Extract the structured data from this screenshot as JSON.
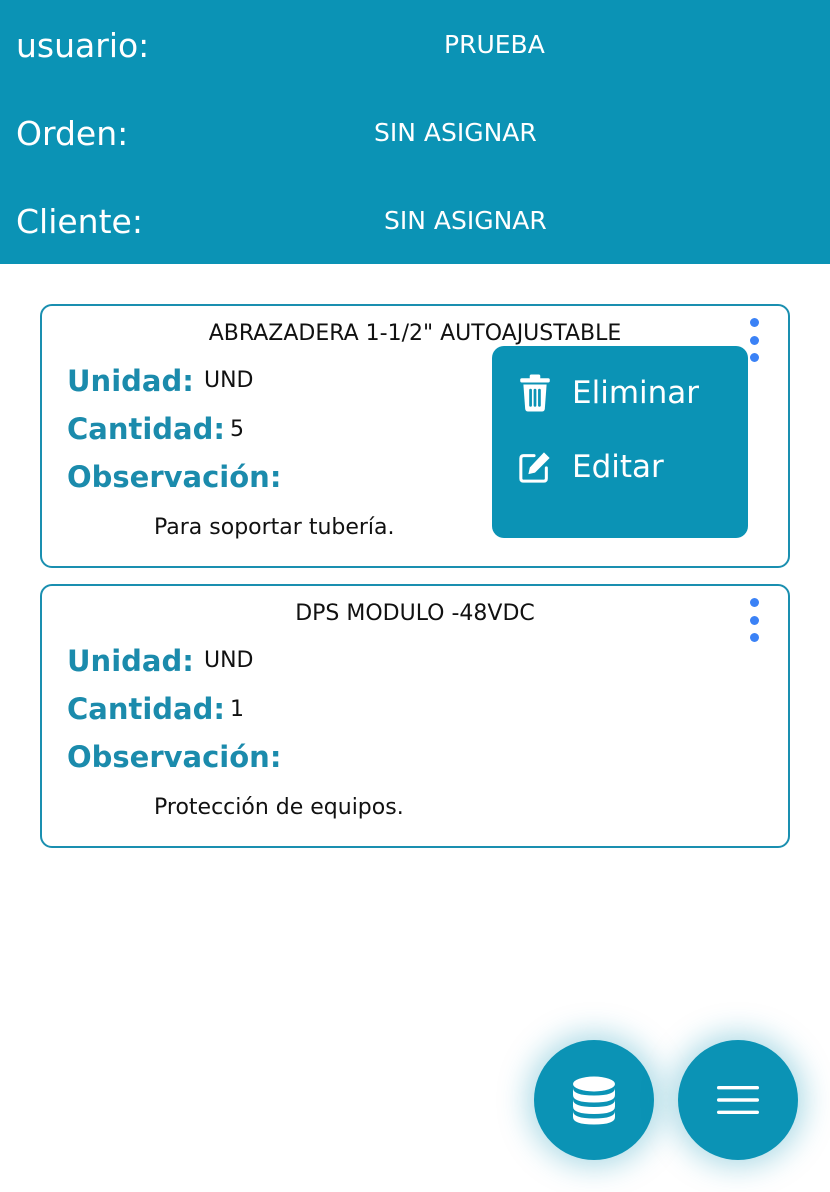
{
  "header": {
    "user_label": "usuario:",
    "user_value": "PRUEBA",
    "order_label": "Orden:",
    "order_value": "SIN ASIGNAR",
    "client_label": "Cliente:",
    "client_value": "SIN ASIGNAR"
  },
  "field_labels": {
    "unit": "Unidad:",
    "quantity": "Cantidad:",
    "observation": "Observación:"
  },
  "items": [
    {
      "title": "ABRAZADERA 1-1/2\" AUTOAJUSTABLE",
      "unit": "UND",
      "quantity": "5",
      "observation": "Para soportar tubería."
    },
    {
      "title": "DPS MODULO -48VDC",
      "unit": "UND",
      "quantity": "1",
      "observation": "Protección de equipos."
    }
  ],
  "context_menu": {
    "delete_label": "Eliminar",
    "edit_label": "Editar"
  },
  "fabs": {
    "database_icon": "database-icon",
    "menu_icon": "hamburger-menu-icon"
  },
  "colors": {
    "primary": "#0b93b5",
    "label": "#1b8bac",
    "kebab": "#3b82f6"
  }
}
